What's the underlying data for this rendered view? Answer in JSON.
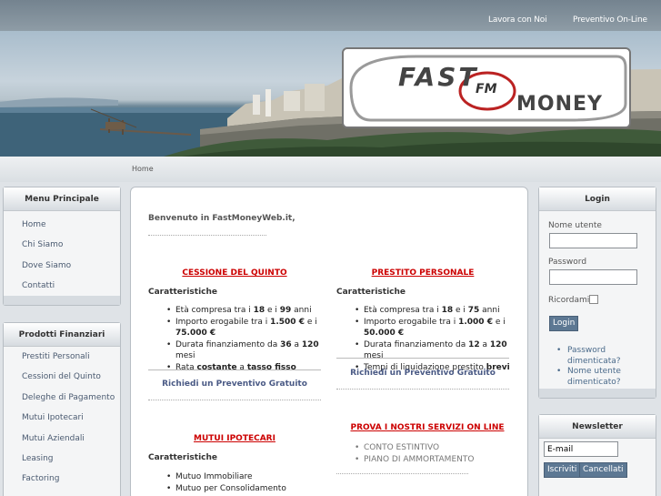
{
  "top_nav": {
    "lavora": "Lavora con Noi",
    "preventivo": "Preventivo On-Line"
  },
  "logo": {
    "line1": "FAST",
    "badge": "FM",
    "line2": "MONEY"
  },
  "breadcrumb": "Home",
  "menu_principale": {
    "title": "Menu Principale",
    "items": [
      "Home",
      "Chi Siamo",
      "Dove Siamo",
      "Contatti"
    ]
  },
  "prodotti": {
    "title": "Prodotti Finanziari",
    "items": [
      "Prestiti Personali",
      "Cessioni del Quinto",
      "Deleghe di Pagamento",
      "Mutui Ipotecari",
      "Mutui Aziendali",
      "Leasing",
      "Factoring"
    ]
  },
  "main": {
    "welcome": "Benvenuto in FastMoneyWeb.it,",
    "cessione": {
      "title": "CESSIONE DEL QUINTO",
      "heading": "Caratteristiche",
      "items": [
        {
          "a": "Età compresa tra i ",
          "b": "18",
          "c": " e i ",
          "d": "99",
          "e": " anni"
        },
        {
          "a": "Importo erogabile tra i ",
          "b": "1.500 €",
          "c": " e i ",
          "d": "75.000 €",
          "e": ""
        },
        {
          "a": "Durata finanziamento da ",
          "b": "36",
          "c": " a ",
          "d": "120",
          "e": " mesi"
        },
        {
          "a": "Rata ",
          "b": "costante",
          "c": " a ",
          "d": "tasso fisso",
          "e": ""
        }
      ],
      "cta": "Richiedi un Preventivo Gratuito"
    },
    "prestito": {
      "title": "PRESTITO PERSONALE",
      "heading": "Caratteristiche",
      "items": [
        {
          "a": "Età compresa tra i ",
          "b": "18",
          "c": " e i ",
          "d": "75",
          "e": " anni"
        },
        {
          "a": "Importo erogabile tra i ",
          "b": "1.000 €",
          "c": " e i ",
          "d": "50.000 €",
          "e": ""
        },
        {
          "a": "Durata finanziamento da ",
          "b": "12",
          "c": " a ",
          "d": "120",
          "e": " mesi"
        },
        {
          "a": "Tempi di liquidazione prestito ",
          "b": "brevi",
          "c": "",
          "d": "",
          "e": ""
        }
      ],
      "cta": "Richiedi un Preventivo Gratuito"
    },
    "mutui": {
      "title": "MUTUI IPOTECARI",
      "heading": "Caratteristiche",
      "items": [
        "Mutuo Immobiliare",
        "Mutuo per Consolidamento"
      ]
    },
    "servizi": {
      "title": "PROVA I NOSTRI SERVIZI ON LINE",
      "items": [
        "CONTO ESTINTIVO",
        "PIANO DI AMMORTAMENTO"
      ]
    }
  },
  "login": {
    "title": "Login",
    "username_label": "Nome utente",
    "password_label": "Password",
    "remember_label": "Ricordami",
    "button": "Login",
    "links": [
      "Password dimenticata?",
      "Nome utente dimenticato?"
    ]
  },
  "newsletter": {
    "title": "Newsletter",
    "email_value": "E-mail",
    "subscribe": "Iscriviti",
    "cancel": "Cancellati"
  },
  "colors": {
    "accent_red": "#cc0000",
    "link_blue": "#4a5a85",
    "button_blue": "#5d7893"
  }
}
